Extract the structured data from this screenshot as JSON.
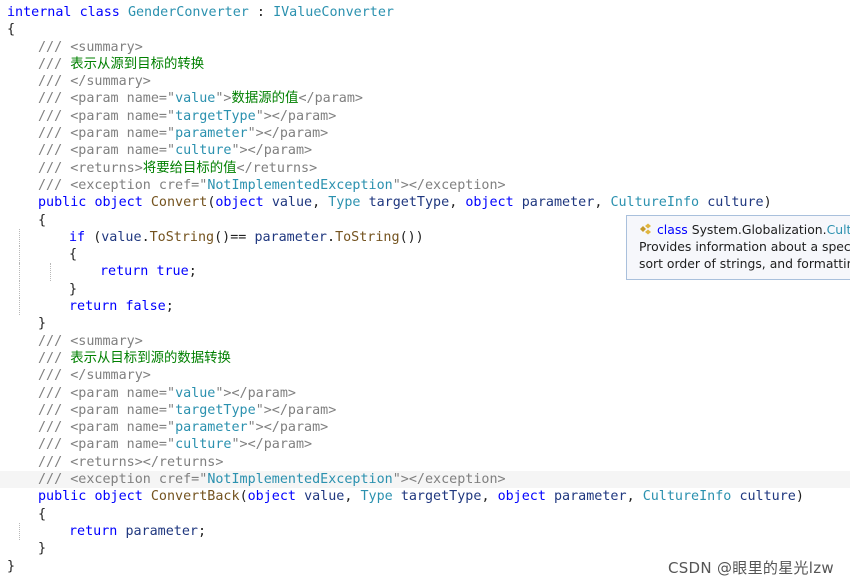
{
  "colors": {
    "keyword": "#0000ff",
    "type": "#2b91af",
    "string": "#a31515",
    "comment": "#808080",
    "doc": "#008000",
    "text": "#1f1f1f",
    "method": "#74531f",
    "param": "#1f377f"
  },
  "code_lines": [
    {
      "indent": 0,
      "tokens": [
        {
          "t": "internal ",
          "c": "keyword"
        },
        {
          "t": "class ",
          "c": "keyword"
        },
        {
          "t": "GenderConverter",
          "c": "type"
        },
        {
          "t": " : ",
          "c": "text"
        },
        {
          "t": "IValueConverter",
          "c": "type"
        }
      ]
    },
    {
      "indent": 0,
      "tokens": [
        {
          "t": "{",
          "c": "text"
        }
      ]
    },
    {
      "indent": 1,
      "tokens": [
        {
          "t": "/// ",
          "c": "comment"
        },
        {
          "t": "<summary>",
          "c": "comment"
        }
      ]
    },
    {
      "indent": 1,
      "tokens": [
        {
          "t": "/// ",
          "c": "comment"
        },
        {
          "t": "表示从源到目标的转换",
          "c": "doc"
        }
      ]
    },
    {
      "indent": 1,
      "tokens": [
        {
          "t": "/// ",
          "c": "comment"
        },
        {
          "t": "</summary>",
          "c": "comment"
        }
      ]
    },
    {
      "indent": 1,
      "tokens": [
        {
          "t": "/// ",
          "c": "comment"
        },
        {
          "t": "<param name=\"",
          "c": "comment"
        },
        {
          "t": "value",
          "c": "type"
        },
        {
          "t": "\">",
          "c": "comment"
        },
        {
          "t": "数据源的值",
          "c": "doc"
        },
        {
          "t": "</param>",
          "c": "comment"
        }
      ]
    },
    {
      "indent": 1,
      "tokens": [
        {
          "t": "/// ",
          "c": "comment"
        },
        {
          "t": "<param name=\"",
          "c": "comment"
        },
        {
          "t": "targetType",
          "c": "type"
        },
        {
          "t": "\"></param>",
          "c": "comment"
        }
      ]
    },
    {
      "indent": 1,
      "tokens": [
        {
          "t": "/// ",
          "c": "comment"
        },
        {
          "t": "<param name=\"",
          "c": "comment"
        },
        {
          "t": "parameter",
          "c": "type"
        },
        {
          "t": "\"></param>",
          "c": "comment"
        }
      ]
    },
    {
      "indent": 1,
      "tokens": [
        {
          "t": "/// ",
          "c": "comment"
        },
        {
          "t": "<param name=\"",
          "c": "comment"
        },
        {
          "t": "culture",
          "c": "type"
        },
        {
          "t": "\"></param>",
          "c": "comment"
        }
      ]
    },
    {
      "indent": 1,
      "tokens": [
        {
          "t": "/// ",
          "c": "comment"
        },
        {
          "t": "<returns>",
          "c": "comment"
        },
        {
          "t": "将要给目标的值",
          "c": "doc"
        },
        {
          "t": "</returns>",
          "c": "comment"
        }
      ]
    },
    {
      "indent": 1,
      "tokens": [
        {
          "t": "/// ",
          "c": "comment"
        },
        {
          "t": "<exception cref=\"",
          "c": "comment"
        },
        {
          "t": "NotImplementedException",
          "c": "type"
        },
        {
          "t": "\"></exception>",
          "c": "comment"
        }
      ]
    },
    {
      "indent": 1,
      "tokens": [
        {
          "t": "public ",
          "c": "keyword"
        },
        {
          "t": "object ",
          "c": "keyword"
        },
        {
          "t": "Convert",
          "c": "method"
        },
        {
          "t": "(",
          "c": "text"
        },
        {
          "t": "object ",
          "c": "keyword"
        },
        {
          "t": "value",
          "c": "param"
        },
        {
          "t": ", ",
          "c": "text"
        },
        {
          "t": "Type ",
          "c": "type"
        },
        {
          "t": "targetType",
          "c": "param"
        },
        {
          "t": ", ",
          "c": "text"
        },
        {
          "t": "object ",
          "c": "keyword"
        },
        {
          "t": "parameter",
          "c": "param"
        },
        {
          "t": ", ",
          "c": "text"
        },
        {
          "t": "CultureInfo ",
          "c": "type"
        },
        {
          "t": "culture",
          "c": "param"
        },
        {
          "t": ")",
          "c": "text"
        }
      ]
    },
    {
      "indent": 1,
      "tokens": [
        {
          "t": "{",
          "c": "text"
        }
      ]
    },
    {
      "indent": 2,
      "tokens": [
        {
          "t": "if ",
          "c": "keyword"
        },
        {
          "t": "(",
          "c": "text"
        },
        {
          "t": "value",
          "c": "param"
        },
        {
          "t": ".",
          "c": "text"
        },
        {
          "t": "ToString",
          "c": "method"
        },
        {
          "t": "()== ",
          "c": "text"
        },
        {
          "t": "parameter",
          "c": "param"
        },
        {
          "t": ".",
          "c": "text"
        },
        {
          "t": "ToString",
          "c": "method"
        },
        {
          "t": "())",
          "c": "text"
        }
      ]
    },
    {
      "indent": 2,
      "tokens": [
        {
          "t": "{",
          "c": "text"
        }
      ]
    },
    {
      "indent": 3,
      "tokens": [
        {
          "t": "return ",
          "c": "keyword"
        },
        {
          "t": "true",
          "c": "keyword"
        },
        {
          "t": ";",
          "c": "text"
        }
      ]
    },
    {
      "indent": 2,
      "tokens": [
        {
          "t": "}",
          "c": "text"
        }
      ]
    },
    {
      "indent": 2,
      "tokens": [
        {
          "t": "return ",
          "c": "keyword"
        },
        {
          "t": "false",
          "c": "keyword"
        },
        {
          "t": ";",
          "c": "text"
        }
      ]
    },
    {
      "indent": 1,
      "tokens": [
        {
          "t": "}",
          "c": "text"
        }
      ]
    },
    {
      "indent": 1,
      "tokens": [
        {
          "t": "/// ",
          "c": "comment"
        },
        {
          "t": "<summary>",
          "c": "comment"
        }
      ]
    },
    {
      "indent": 1,
      "tokens": [
        {
          "t": "/// ",
          "c": "comment"
        },
        {
          "t": "表示从目标到源的数据转换",
          "c": "doc"
        }
      ]
    },
    {
      "indent": 1,
      "tokens": [
        {
          "t": "/// ",
          "c": "comment"
        },
        {
          "t": "</summary>",
          "c": "comment"
        }
      ]
    },
    {
      "indent": 1,
      "tokens": [
        {
          "t": "/// ",
          "c": "comment"
        },
        {
          "t": "<param name=\"",
          "c": "comment"
        },
        {
          "t": "value",
          "c": "type"
        },
        {
          "t": "\"></param>",
          "c": "comment"
        }
      ]
    },
    {
      "indent": 1,
      "tokens": [
        {
          "t": "/// ",
          "c": "comment"
        },
        {
          "t": "<param name=\"",
          "c": "comment"
        },
        {
          "t": "targetType",
          "c": "type"
        },
        {
          "t": "\"></param>",
          "c": "comment"
        }
      ]
    },
    {
      "indent": 1,
      "tokens": [
        {
          "t": "/// ",
          "c": "comment"
        },
        {
          "t": "<param name=\"",
          "c": "comment"
        },
        {
          "t": "parameter",
          "c": "type"
        },
        {
          "t": "\"></param>",
          "c": "comment"
        }
      ]
    },
    {
      "indent": 1,
      "tokens": [
        {
          "t": "/// ",
          "c": "comment"
        },
        {
          "t": "<param name=\"",
          "c": "comment"
        },
        {
          "t": "culture",
          "c": "type"
        },
        {
          "t": "\"></param>",
          "c": "comment"
        }
      ]
    },
    {
      "indent": 1,
      "tokens": [
        {
          "t": "/// ",
          "c": "comment"
        },
        {
          "t": "<returns></returns>",
          "c": "comment"
        }
      ]
    },
    {
      "indent": 1,
      "highlight": true,
      "tokens": [
        {
          "t": "/// ",
          "c": "comment"
        },
        {
          "t": "<exception cref=\"",
          "c": "comment"
        },
        {
          "t": "NotImplementedException",
          "c": "type"
        },
        {
          "t": "\"></exception>",
          "c": "comment"
        }
      ]
    },
    {
      "indent": 1,
      "tokens": [
        {
          "t": "public ",
          "c": "keyword"
        },
        {
          "t": "object ",
          "c": "keyword"
        },
        {
          "t": "ConvertBack",
          "c": "method"
        },
        {
          "t": "(",
          "c": "text"
        },
        {
          "t": "object ",
          "c": "keyword"
        },
        {
          "t": "value",
          "c": "param"
        },
        {
          "t": ", ",
          "c": "text"
        },
        {
          "t": "Type ",
          "c": "type"
        },
        {
          "t": "targetType",
          "c": "param"
        },
        {
          "t": ", ",
          "c": "text"
        },
        {
          "t": "object ",
          "c": "keyword"
        },
        {
          "t": "parameter",
          "c": "param"
        },
        {
          "t": ", ",
          "c": "text"
        },
        {
          "t": "CultureInfo ",
          "c": "type"
        },
        {
          "t": "culture",
          "c": "param"
        },
        {
          "t": ")",
          "c": "text"
        }
      ]
    },
    {
      "indent": 1,
      "tokens": [
        {
          "t": "{",
          "c": "text"
        }
      ]
    },
    {
      "indent": 2,
      "tokens": [
        {
          "t": "return ",
          "c": "keyword"
        },
        {
          "t": "parameter",
          "c": "param"
        },
        {
          "t": ";",
          "c": "text"
        }
      ]
    },
    {
      "indent": 1,
      "tokens": [
        {
          "t": "}",
          "c": "text"
        }
      ]
    },
    {
      "indent": 0,
      "tokens": [
        {
          "t": "}",
          "c": "text"
        }
      ]
    }
  ],
  "tooltip": {
    "icon": "class-icon",
    "kind": "class",
    "namespace": "System.Globalization.",
    "name": "Cultu",
    "line1": "Provides information about a specifi",
    "line2": "sort order of strings, and formatting"
  },
  "watermark": "CSDN @眼里的星光lzw"
}
